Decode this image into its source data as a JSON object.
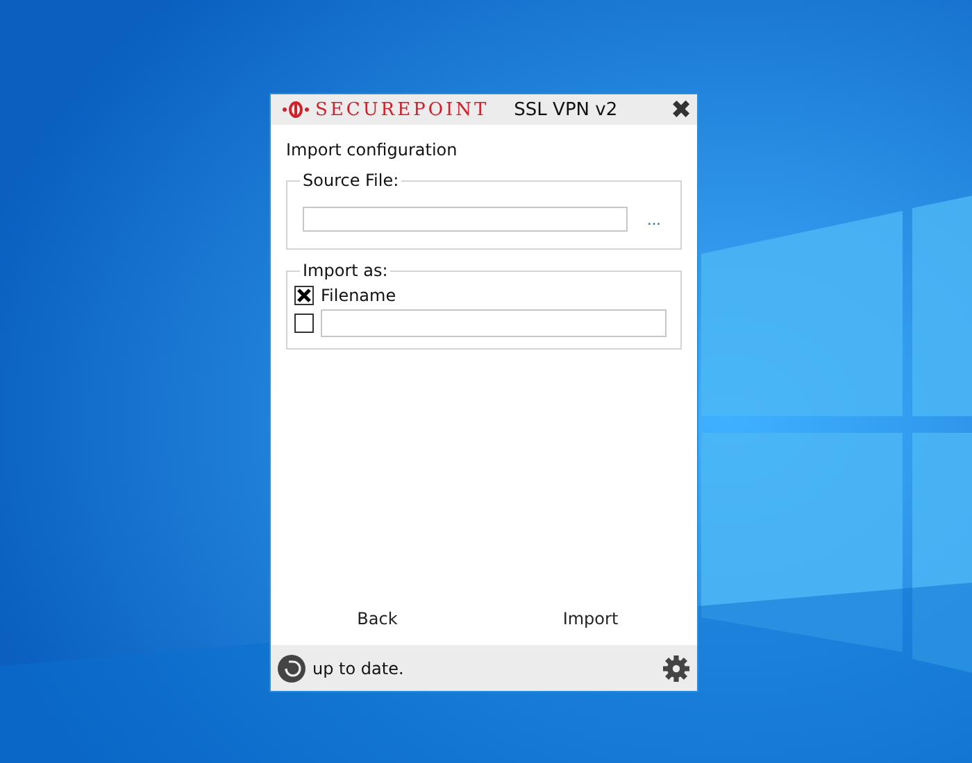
{
  "window": {
    "brand": "SECUREPOINT",
    "title": "SSL VPN v2",
    "close": "✖"
  },
  "heading": "Import configuration",
  "source_group": {
    "legend": "Source File:",
    "browse": "..."
  },
  "import_group": {
    "legend": "Import as:",
    "options": [
      {
        "kind": "label",
        "checked": true,
        "label": "Filename"
      },
      {
        "kind": "field",
        "checked": false
      }
    ]
  },
  "buttons": [
    "Back",
    "Import"
  ],
  "status_bar": {
    "text": "up to date."
  }
}
